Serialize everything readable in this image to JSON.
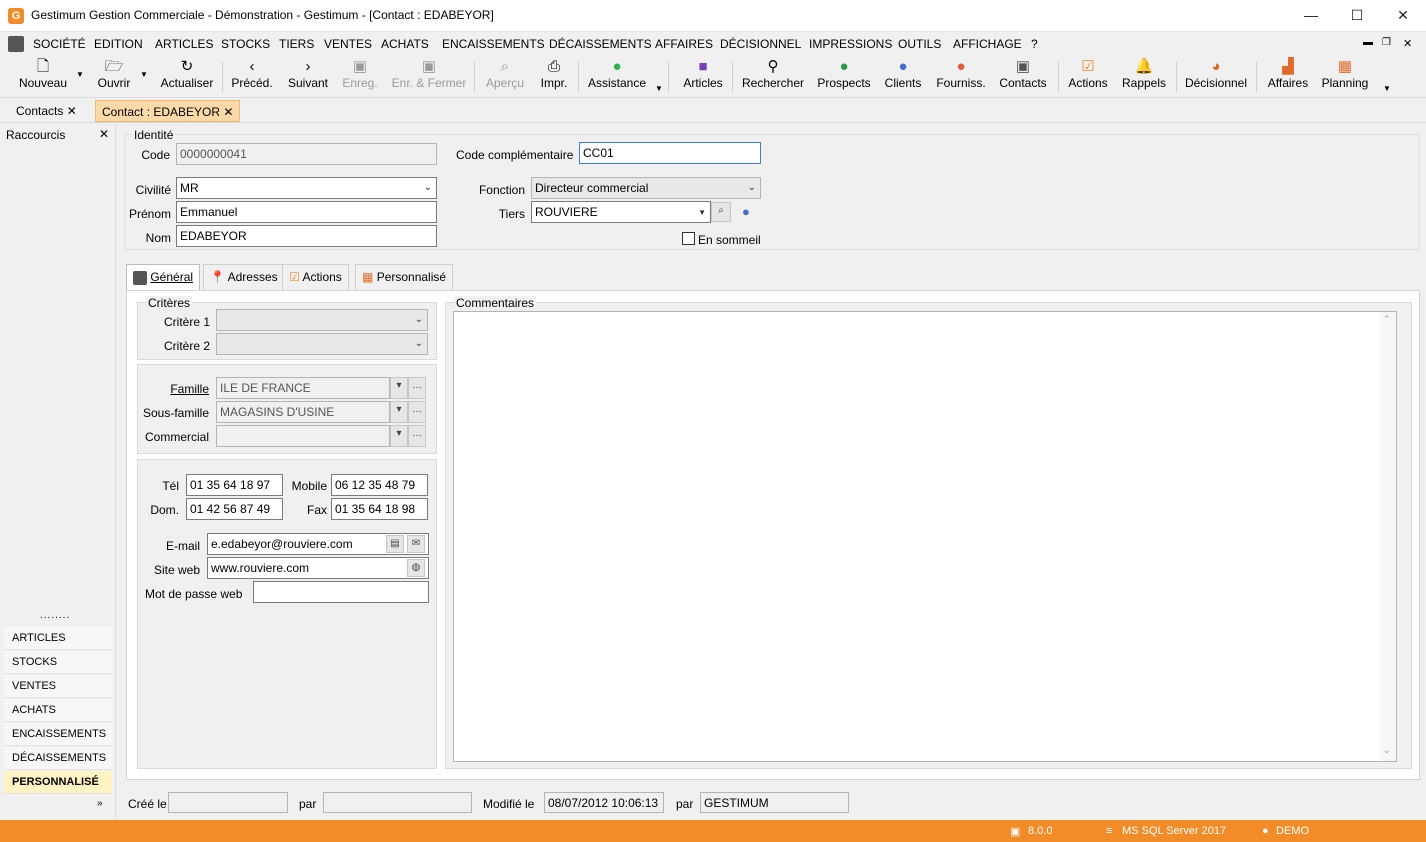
{
  "window": {
    "title": "Gestimum Gestion Commerciale - Démonstration - Gestimum - [Contact : EDABEYOR]",
    "logo": "G",
    "controls": {
      "minimize": "—",
      "maximize": "☐",
      "close": "✕"
    }
  },
  "menu": [
    "SOCIÉTÉ",
    "EDITION",
    "ARTICLES",
    "STOCKS",
    "TIERS",
    "VENTES",
    "ACHATS",
    "ENCAISSEMENTS",
    "DÉCAISSEMENTS",
    "AFFAIRES",
    "DÉCISIONNEL",
    "IMPRESSIONS",
    "OUTILS",
    "AFFICHAGE",
    "?"
  ],
  "toolbar": {
    "nouveau": "Nouveau",
    "ouvrir": "Ouvrir",
    "actualiser": "Actualiser",
    "preced": "Précéd.",
    "suivant": "Suivant",
    "enreg": "Enreg.",
    "enreg_fermer": "Enr. & Fermer",
    "apercu": "Aperçu",
    "impr": "Impr.",
    "assistance": "Assistance",
    "articles": "Articles",
    "rechercher": "Rechercher",
    "prospects": "Prospects",
    "clients": "Clients",
    "fourniss": "Fourniss.",
    "contacts": "Contacts",
    "actions": "Actions",
    "rappels": "Rappels",
    "decisionnel": "Décisionnel",
    "affaires": "Affaires",
    "planning": "Planning"
  },
  "doc_tabs": {
    "contacts": "Contacts",
    "contact_edabeyor": "Contact : EDABEYOR"
  },
  "sidebar": {
    "title": "Raccourcis",
    "items": [
      "ARTICLES",
      "STOCKS",
      "VENTES",
      "ACHATS",
      "ENCAISSEMENTS",
      "DÉCAISSEMENTS",
      "PERSONNALISÉ"
    ],
    "active": "PERSONNALISÉ"
  },
  "identite": {
    "legend": "Identité",
    "code_label": "Code",
    "code": "0000000041",
    "civilite_label": "Civilité",
    "civilite": "MR",
    "prenom_label": "Prénom",
    "prenom": "Emmanuel",
    "nom_label": "Nom",
    "nom": "EDABEYOR",
    "code_compl_label": "Code complémentaire",
    "code_compl": "CC01",
    "fonction_label": "Fonction",
    "fonction": "Directeur commercial",
    "tiers_label": "Tiers",
    "tiers": "ROUVIERE",
    "en_sommeil_label": "En sommeil",
    "en_sommeil": false
  },
  "tabs": [
    "Général",
    "Adresses",
    "Actions",
    "Personnalisé"
  ],
  "general": {
    "criteres_legend": "Critères",
    "critere1_label": "Critère 1",
    "critere1": "",
    "critere2_label": "Critère 2",
    "critere2": "",
    "famille_label": "Famille",
    "famille": "ILE DE FRANCE",
    "sousfamille_label": "Sous-famille",
    "sousfamille": "MAGASINS D'USINE",
    "commercial_label": "Commercial",
    "commercial": "",
    "tel_label": "Tél",
    "tel": "01 35 64 18 97",
    "mobile_label": "Mobile",
    "mobile": "06 12 35 48 79",
    "dom_label": "Dom.",
    "dom": "01 42 56 87 49",
    "fax_label": "Fax",
    "fax": "01 35 64 18 98",
    "email_label": "E-mail",
    "email": "e.edabeyor@rouviere.com",
    "site_label": "Site web",
    "site": "www.rouviere.com",
    "mdp_label": "Mot de passe web",
    "mdp": "",
    "commentaires_legend": "Commentaires"
  },
  "footer": {
    "cree_label": "Créé le",
    "cree": "",
    "par1_label": "par",
    "par1": "",
    "modifie_label": "Modifié le",
    "modifie": "08/07/2012 10:06:13",
    "par2_label": "par",
    "par2": "GESTIMUM"
  },
  "status": {
    "version": "8.0.0",
    "server": "MS SQL Server 2017",
    "db": "DEMO"
  },
  "colors": {
    "accent": "#f28c28",
    "active_tab": "#fcd9a8"
  }
}
